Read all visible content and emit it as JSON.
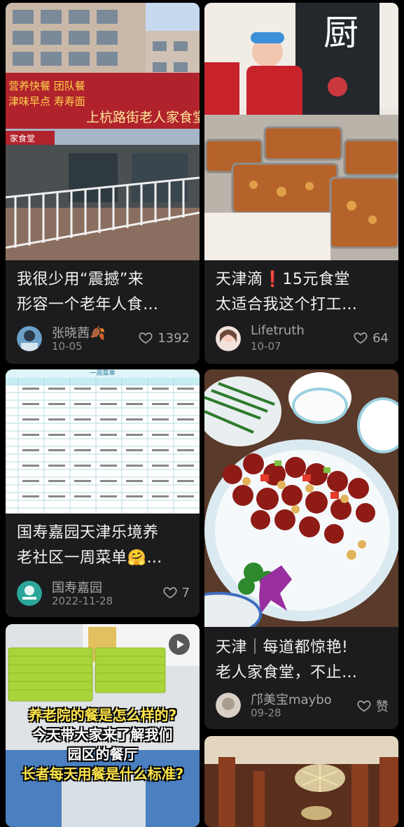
{
  "cards": [
    {
      "id": "card1",
      "image_alt": "上杭路街老人家食堂",
      "sign_text": "上杭路街老人家食堂",
      "sign_left": "营养快餐 团队餐 津味早点 寿寿面",
      "sign_small": "家食堂",
      "title_line1": "我很少用“震撼”来",
      "title_line2": "形容一个老年人食…",
      "author": "张晓茜🍂",
      "date": "10-05",
      "likes": "1392"
    },
    {
      "id": "card2",
      "title_line1": "天津滴❗15元食堂",
      "title_line2": "太适合我这个打工…",
      "author": "Lifetruth",
      "date": "10-07",
      "likes": "64"
    },
    {
      "id": "card3",
      "menu_header": "一周菜单",
      "title_line1": "国寿嘉园天津乐境养",
      "title_line2": "老社区一周菜单🤗…",
      "author": "国寿嘉园",
      "date": "2022-11-28",
      "likes": "7"
    },
    {
      "id": "card4",
      "title_line1": "天津｜每道都惊艳!",
      "title_line2": "老人家食堂，不止…",
      "author": "邝美宝maybo",
      "date": "09-28",
      "likes": "赞"
    },
    {
      "id": "card5",
      "overlay_line1": "养老院的餐是怎么样的?",
      "overlay_line2": "今天带大家来了解我们",
      "overlay_line3": "园区的餐厅",
      "overlay_line4": "长者每天用餐是什么标准?"
    },
    {
      "id": "card6"
    }
  ],
  "colors": {
    "background": "#000000",
    "card": "#1c1c1e",
    "text_primary": "#f2f2f2",
    "text_secondary": "#a7a7a7"
  },
  "icons": {
    "like": "heart-outline-icon",
    "video": "play-icon"
  }
}
